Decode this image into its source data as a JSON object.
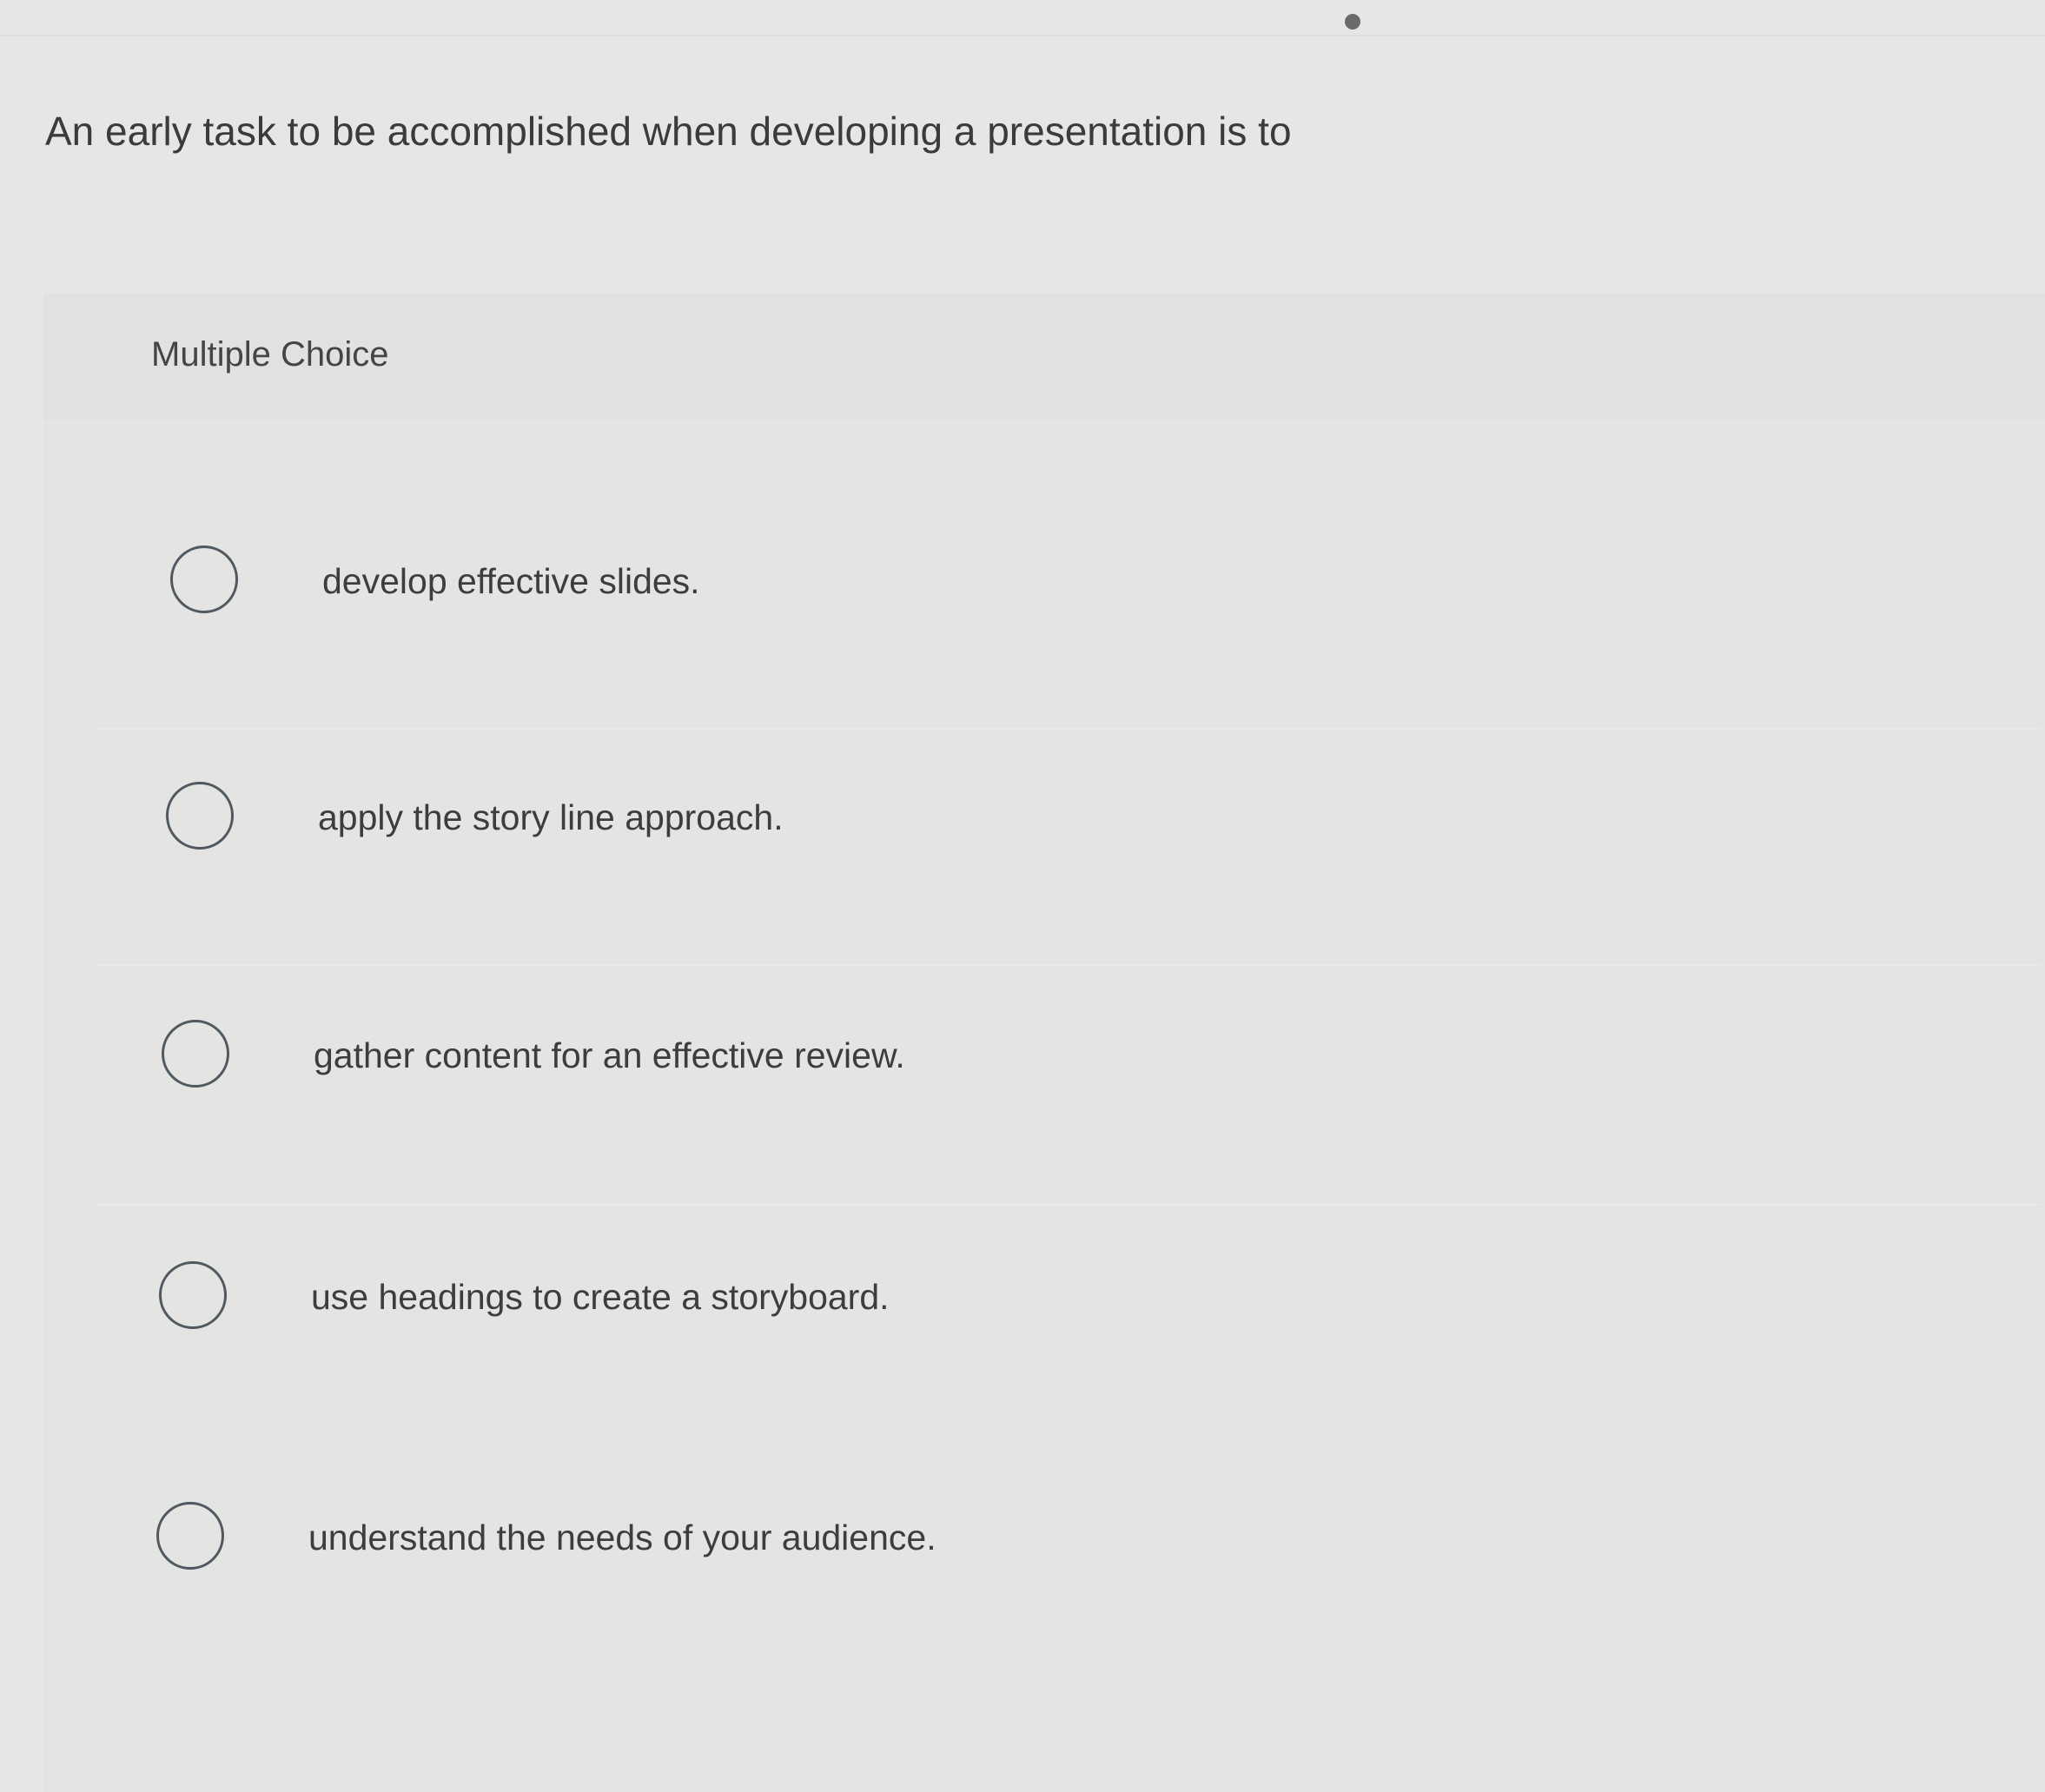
{
  "question": {
    "text": "An early task to be accomplished when developing a presentation is to"
  },
  "answer_panel": {
    "type_label": "Multiple Choice",
    "options": [
      {
        "label": "develop effective slides.",
        "selected": false
      },
      {
        "label": "apply the story line approach.",
        "selected": false
      },
      {
        "label": "gather content for an effective review.",
        "selected": false
      },
      {
        "label": "use headings to create a storyboard.",
        "selected": false
      },
      {
        "label": "understand the needs of your audience.",
        "selected": false
      }
    ]
  }
}
